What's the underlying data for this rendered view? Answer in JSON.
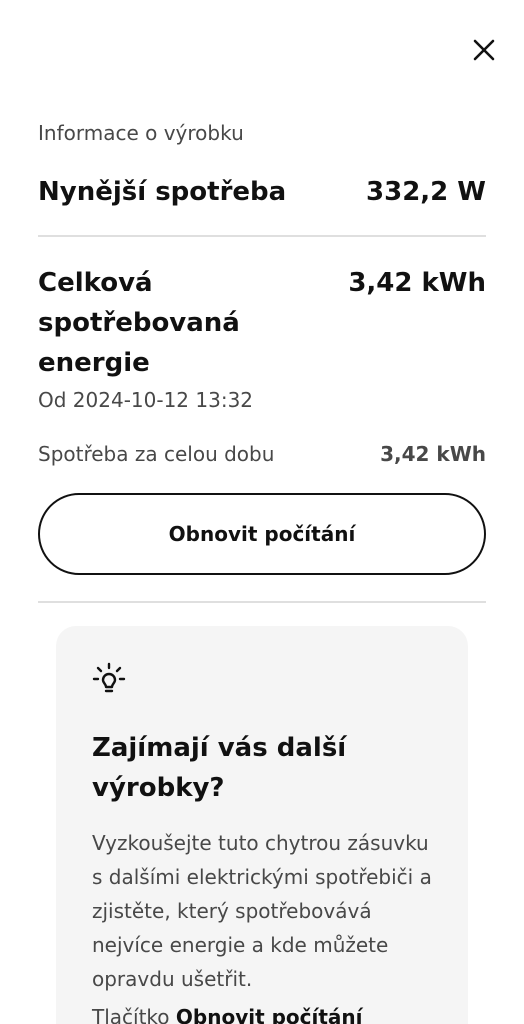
{
  "header": {
    "close_icon": "close-icon"
  },
  "product_info": {
    "section_label": "Informace o výrobku",
    "current_consumption_label": "Nynější spotřeba",
    "current_consumption_value": "332,2 W",
    "total_energy_label": "Celková spotřebovaná energie",
    "total_energy_value": "3,42 kWh",
    "since_text": "Od 2024-10-12 13:32",
    "lifetime_label": "Spotřeba za celou dobu",
    "lifetime_value": "3,42 kWh",
    "reset_button_label": "Obnovit počítání"
  },
  "info_card": {
    "icon": "lightbulb-icon",
    "title": "Zajímají vás další výrobky?",
    "text": "Vyzkoušejte tuto chytrou zásuvku s dalšími elektrickými spotřebiči a zjistěte, který spotřebovává nejvíce energie a kde můžete opravdu ušetřit.",
    "text2_prefix": "Tlačítko ",
    "text2_bold": "Obnovit počítání"
  }
}
